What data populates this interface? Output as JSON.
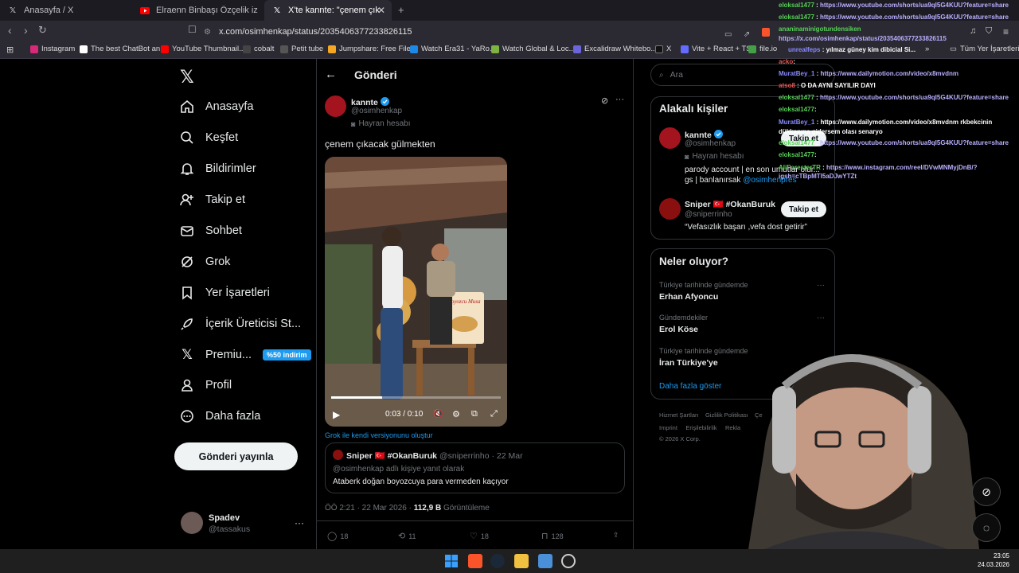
{
  "browser": {
    "tabs": [
      {
        "label": "Anasayfa / X",
        "icon": "x-logo-icon"
      },
      {
        "label": "Elraenn Binbaşı Özçelik izliyor - YouT",
        "icon": "youtube-icon"
      },
      {
        "label": "X'te kannte: \"çenem çıkacak gülr",
        "icon": "x-logo-icon"
      }
    ],
    "url": "x.com/osimhenkap/status/2035406377233826115",
    "bookmarks": [
      {
        "label": "Instagram",
        "color": "#d6297a"
      },
      {
        "label": "The best ChatBot an...",
        "color": "#ffffff"
      },
      {
        "label": "YouTube Thumbnail...",
        "color": "#ff0000"
      },
      {
        "label": "cobalt",
        "color": "#444444"
      },
      {
        "label": "Petit tube",
        "color": "#555555"
      },
      {
        "label": "Jumpshare: Free File...",
        "color": "#f5a623"
      },
      {
        "label": "Watch Era31 - YaRo...",
        "color": "#1e88e5"
      },
      {
        "label": "Watch Global & Loc...",
        "color": "#7cb342"
      },
      {
        "label": "Excalidraw Whitebo...",
        "color": "#6965db"
      },
      {
        "label": "X",
        "color": "#000000"
      },
      {
        "label": "Vite + React + TS",
        "color": "#646cff"
      },
      {
        "label": "file.io",
        "color": "#43a047"
      }
    ],
    "all_bookmarks": "Tüm Yer İşaretleri"
  },
  "sidebar": {
    "items": [
      {
        "label": "Anasayfa"
      },
      {
        "label": "Keşfet"
      },
      {
        "label": "Bildirimler"
      },
      {
        "label": "Takip et"
      },
      {
        "label": "Sohbet"
      },
      {
        "label": "Grok"
      },
      {
        "label": "Yer İşaretleri"
      },
      {
        "label": "İçerik Üreticisi St..."
      },
      {
        "label": "Premiu...",
        "badge": "%50 indirim"
      },
      {
        "label": "Profil"
      },
      {
        "label": "Daha fazla"
      }
    ],
    "post_button": "Gönderi yayınla",
    "account": {
      "name": "Spadev",
      "handle": "@tassakus"
    }
  },
  "post": {
    "header": "Gönderi",
    "author": "kannte",
    "handle": "@osimhenkap",
    "fan_label": "Hayran hesabı",
    "text": "çenem çıkacak gülmekten",
    "video": {
      "time": "0:03 / 0:10",
      "sign_title": "Boyozcu Musa",
      "progress": 0.3
    },
    "grok_link": "Grok ile kendi versiyonunu oluştur",
    "quoted": {
      "author": "Sniper 🇹🇷 #OkanBuruk",
      "handle": "@sniperrinho",
      "date": "· 22 Mar",
      "reply_to": "@osimhenkap adlı kişiye yanıt olarak",
      "text": "Ataberk doğan boyozcuya para vermeden kaçıyor"
    },
    "meta_time": "ÖÖ 2:21 · 22 Mar 2026 ·",
    "meta_views_count": "112,9 B",
    "meta_views_label": "Görüntüleme",
    "actions": {
      "replies": "18",
      "reposts": "11",
      "likes": "18",
      "bookmarks": "128"
    }
  },
  "right": {
    "search_placeholder": "Ara",
    "related_title": "Alakalı kişiler",
    "people": [
      {
        "name": "kannte",
        "handle": "@osimhenkap",
        "fan_label": "Hayran hesabı",
        "bio": "parody account | en son umutlar olur... gs | banlanırsak",
        "bio_link": "@osimhenpres",
        "follow": "Takip et"
      },
      {
        "name": "Sniper 🇹🇷 #OkanBuruk",
        "handle": "@sniperrinho",
        "bio": "“Vefasızlık başarı ,vefa dost getirir”",
        "follow": "Takip et"
      }
    ],
    "trends_title": "Neler oluyor?",
    "trends": [
      {
        "category": "Türkiye tarihinde gündemde",
        "name": "Erhan Afyoncu"
      },
      {
        "category": "Gündemdekiler",
        "name": "Erol Köse"
      },
      {
        "category": "Türkiye tarihinde gündemde",
        "name": "İran Türkiye'ye"
      }
    ],
    "show_more": "Daha fazla göster",
    "footer": [
      "Hizmet Şartları",
      "Gizlilik Politikası",
      "Çe",
      "Imprint",
      "Erişilebilirlik",
      "Rekla",
      "© 2026 X Corp."
    ]
  },
  "chat": [
    {
      "user": "eloksal1477",
      "msg": "https://www.youtube.com/shorts/ua9qI5G4KUU?feature=share",
      "ucolor": "green"
    },
    {
      "user": "eloksal1477",
      "msg": "https://www.youtube.com/shorts/ua9qI5G4KUU?feature=share",
      "ucolor": "green"
    },
    {
      "user": "ananinaminigotundensiken",
      "msg": "https://x.com/osimhenkap/status/2035406377233826115",
      "ucolor": "green"
    },
    {
      "user": "unrealfeps",
      "msg": "yılmaz güney kim dibicial Si...",
      "ucolor": "blue"
    },
    {
      "user": "acko",
      "msg": ":",
      "ucolor": "red"
    },
    {
      "user": "MuratBey_1",
      "msg": "https://www.dailymotion.com/video/x8mvdnm",
      "ucolor": "blue"
    },
    {
      "user": "atso8",
      "msg": "O DA AYNI SAYILIR DAYI",
      "ucolor": "red"
    },
    {
      "user": "eloksal1477",
      "msg": "https://www.youtube.com/shorts/ua9qI5G4KUU?feature=share",
      "ucolor": "green"
    },
    {
      "user": "eloksal1477",
      "msg": ":",
      "ucolor": "green"
    },
    {
      "user": "MuratBey_1",
      "msg": "https://www.dailymotion.com/video/x8mvdnm rkbekcinin dükkanına gidersem olası senaryo",
      "ucolor": "blue"
    },
    {
      "user": "eloksal1477",
      "msg": "https://www.youtube.com/shorts/ua9qI5G4KUU?feature=share",
      "ucolor": "green"
    },
    {
      "user": "eloksal1477",
      "msg": ":",
      "ucolor": "green"
    },
    {
      "user": "AliForesterTR",
      "msg": "https://www.instagram.com/reel/DVwMNMyjDnB/?igsh=cTBpMTI5aDJwYTZt",
      "ucolor": "green"
    }
  ],
  "taskbar": {
    "time": "23:05",
    "date": "24.03.2026"
  },
  "colors": {
    "accent": "#1d9bf0",
    "bg": "#000000",
    "border": "#2f3336"
  }
}
